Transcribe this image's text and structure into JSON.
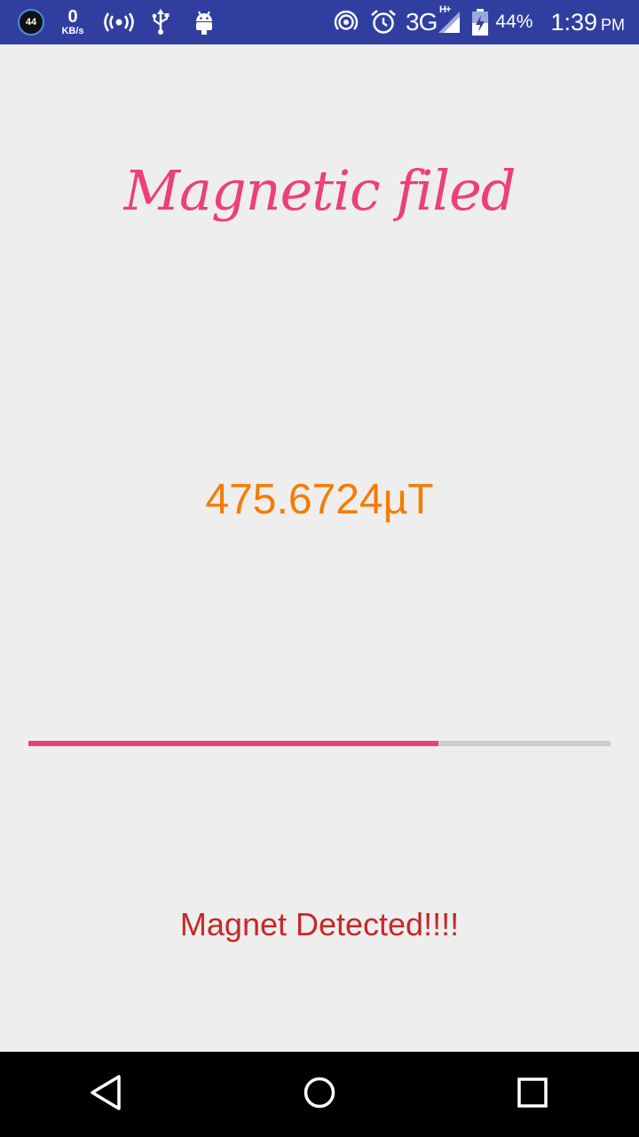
{
  "status_bar": {
    "notification_count": "44",
    "net_speed_value": "0",
    "net_speed_unit": "KB/s",
    "network_type": "3G",
    "network_sub": "H+",
    "battery_percent": "44%",
    "time": "1:39",
    "ampm": "PM",
    "icons": [
      "hotspot-icon",
      "usb-icon",
      "android-debug-icon",
      "nfc-icon",
      "alarm-icon",
      "signal-icon",
      "battery-icon"
    ]
  },
  "main": {
    "title": "Magnetic filed",
    "reading": "475.6724µT",
    "progress_percent": 70.5,
    "status_message": "Magnet Detected!!!!"
  },
  "nav": {
    "buttons": [
      "back-icon",
      "home-icon",
      "recents-icon"
    ]
  },
  "colors": {
    "status_bar": "#303f9f",
    "title": "#ec407a",
    "reading": "#f57c00",
    "progress_fill": "#ec407a",
    "progress_track": "#cccccc",
    "status_message": "#c62828",
    "background": "#eeeeee"
  }
}
